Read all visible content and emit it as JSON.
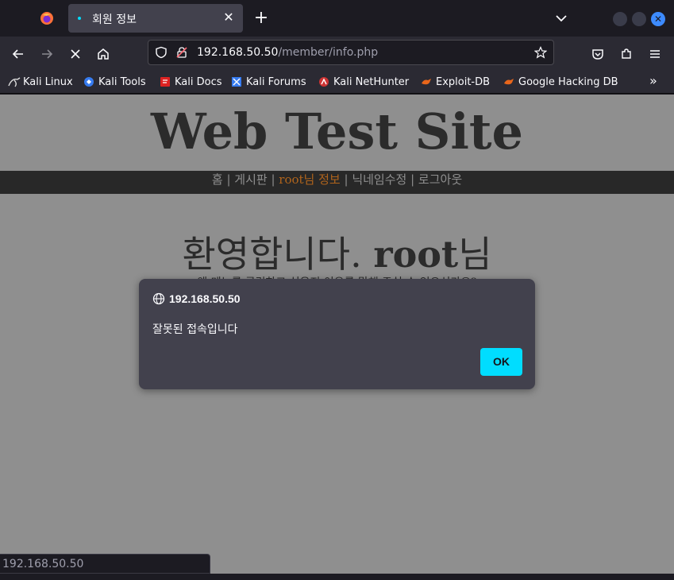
{
  "tab": {
    "title": "회원 정보",
    "close": "✕"
  },
  "new_tab": "+",
  "window": {
    "close": "✕"
  },
  "url": {
    "host": "192.168.50.50",
    "path": "/member/info.php"
  },
  "bookmarks": [
    {
      "label": "Kali Linux",
      "icon": "kali-dragon-icon"
    },
    {
      "label": "Kali Tools",
      "icon": "kali-tools-icon"
    },
    {
      "label": "Kali Docs",
      "icon": "kali-docs-icon"
    },
    {
      "label": "Kali Forums",
      "icon": "kali-forums-icon"
    },
    {
      "label": "Kali NetHunter",
      "icon": "nethunter-icon"
    },
    {
      "label": "Exploit-DB",
      "icon": "exploit-db-icon"
    },
    {
      "label": "Google Hacking DB",
      "icon": "ghdb-icon"
    }
  ],
  "bookmarks_more": "»",
  "site": {
    "title": "Web Test Site",
    "menu": [
      "홈",
      "게시판",
      "root님 정보",
      "닉네임수정",
      "로그아웃"
    ],
    "menu_separator": " | ",
    "welcome_prefix": "환영합니다. ",
    "welcome_user": "root",
    "welcome_suffix": "님",
    "subline": "왜 메뉴를 클릭하고 싶은지 이유를 말해 주실 수 있으신가요?"
  },
  "dialog": {
    "origin": "192.168.50.50",
    "message": "잘못된 접속입니다",
    "ok": "OK"
  },
  "status": "192.168.50.50",
  "colors": {
    "accent": "#00ddff",
    "active_menu": "#b0641c",
    "page_bg": "#8f8f8f"
  }
}
